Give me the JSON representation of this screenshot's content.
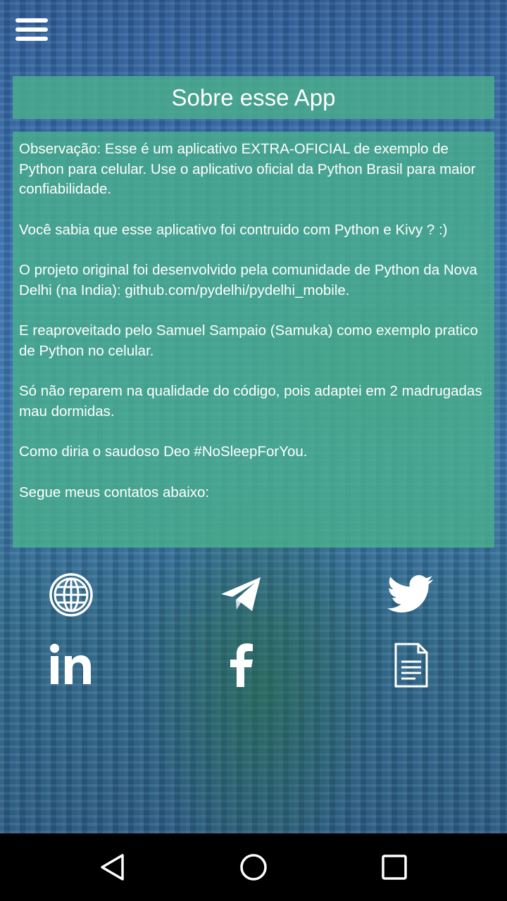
{
  "app": {
    "title": "Sobre esse App",
    "paragraphs": [
      "Observação: Esse é um aplicativo EXTRA-OFICIAL de exemplo de Python para celular. Use o aplicativo oficial da Python Brasil para maior confiabilidade.",
      "Você sabia que esse aplicativo foi contruido com Python e Kivy ? :)",
      "O projeto original foi desenvolvido pela comunidade de Python da Nova Delhi (na India): github.com/pydelhi/pydelhi_mobile.",
      "E reaproveitado pelo Samuel Sampaio (Samuka) como exemplo pratico de Python no celular.",
      "Só não reparem na qualidade do código, pois adaptei em 2 madrugadas mau dormidas.",
      "Como diria o saudoso Deo #NoSleepForYou.",
      "Segue meus contatos abaixo:"
    ]
  },
  "icons": {
    "menu": "hamburger-menu-icon",
    "contacts": [
      "globe-icon",
      "telegram-icon",
      "twitter-icon",
      "linkedin-icon",
      "facebook-icon",
      "document-icon"
    ]
  },
  "navbar": {
    "icons": [
      "back-triangle-icon",
      "home-circle-icon",
      "recents-square-icon"
    ]
  },
  "colors": {
    "panel": "#4ab08c",
    "nav_background": "#000000",
    "text": "#ffffff"
  }
}
